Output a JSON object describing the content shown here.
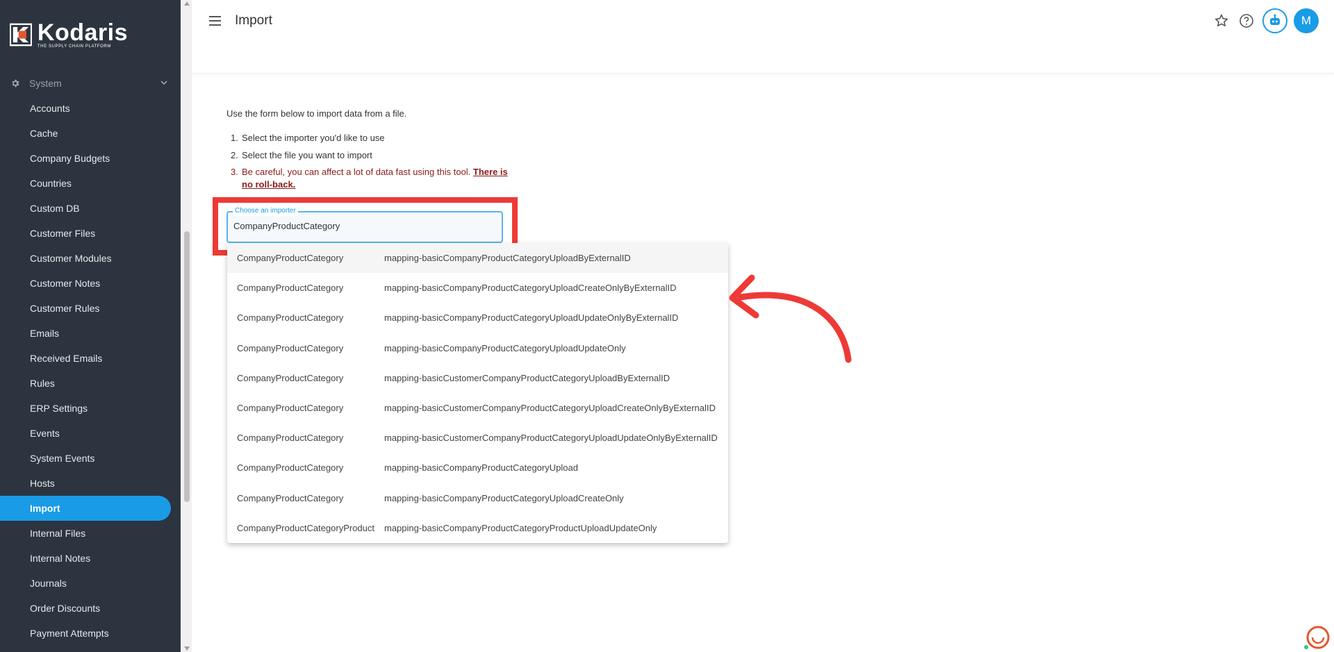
{
  "brand": {
    "name": "Kodaris",
    "tagline": "THE SUPPLY CHAIN PLATFORM"
  },
  "sidebar": {
    "section": "System",
    "items": [
      {
        "label": "Accounts"
      },
      {
        "label": "Cache"
      },
      {
        "label": "Company Budgets"
      },
      {
        "label": "Countries"
      },
      {
        "label": "Custom DB"
      },
      {
        "label": "Customer Files"
      },
      {
        "label": "Customer Modules"
      },
      {
        "label": "Customer Notes"
      },
      {
        "label": "Customer Rules"
      },
      {
        "label": "Emails"
      },
      {
        "label": "Received Emails"
      },
      {
        "label": "Rules"
      },
      {
        "label": "ERP Settings"
      },
      {
        "label": "Events"
      },
      {
        "label": "System Events"
      },
      {
        "label": "Hosts"
      },
      {
        "label": "Import"
      },
      {
        "label": "Internal Files"
      },
      {
        "label": "Internal Notes"
      },
      {
        "label": "Journals"
      },
      {
        "label": "Order Discounts"
      },
      {
        "label": "Payment Attempts"
      }
    ],
    "active_index": 16
  },
  "header": {
    "title": "Import",
    "avatar_initial": "M",
    "icons": [
      "menu-icon",
      "star-icon",
      "help-icon",
      "bot-icon"
    ]
  },
  "main": {
    "intro": "Use the form below to import data from a file.",
    "steps": [
      {
        "num": "1.",
        "text": "Select the importer you'd like to use"
      },
      {
        "num": "2.",
        "text": "Select the file you want to import"
      },
      {
        "num": "3.",
        "text": "Be careful, you can affect a lot of data fast using this tool. ",
        "strong": "There is no roll-back."
      }
    ],
    "importer_field": {
      "label": "Choose an importer",
      "value": "CompanyProductCategory"
    },
    "options": [
      {
        "type": "CompanyProductCategory",
        "mapping": "mapping-basicCompanyProductCategoryUploadByExternalID"
      },
      {
        "type": "CompanyProductCategory",
        "mapping": "mapping-basicCompanyProductCategoryUploadCreateOnlyByExternalID"
      },
      {
        "type": "CompanyProductCategory",
        "mapping": "mapping-basicCompanyProductCategoryUploadUpdateOnlyByExternalID"
      },
      {
        "type": "CompanyProductCategory",
        "mapping": "mapping-basicCompanyProductCategoryUploadUpdateOnly"
      },
      {
        "type": "CompanyProductCategory",
        "mapping": "mapping-basicCustomerCompanyProductCategoryUploadByExternalID"
      },
      {
        "type": "CompanyProductCategory",
        "mapping": "mapping-basicCustomerCompanyProductCategoryUploadCreateOnlyByExternalID"
      },
      {
        "type": "CompanyProductCategory",
        "mapping": "mapping-basicCustomerCompanyProductCategoryUploadUpdateOnlyByExternalID"
      },
      {
        "type": "CompanyProductCategory",
        "mapping": "mapping-basicCompanyProductCategoryUpload"
      },
      {
        "type": "CompanyProductCategory",
        "mapping": "mapping-basicCompanyProductCategoryUploadCreateOnly"
      },
      {
        "type": "CompanyProductCategoryProduct",
        "mapping": "mapping-basicCompanyProductCategoryProductUploadUpdateOnly"
      }
    ]
  },
  "colors": {
    "sidebar_bg": "#2c3440",
    "accent": "#1a9be6",
    "annotation": "#ee3a36",
    "warning_text": "#8b1a1a"
  }
}
